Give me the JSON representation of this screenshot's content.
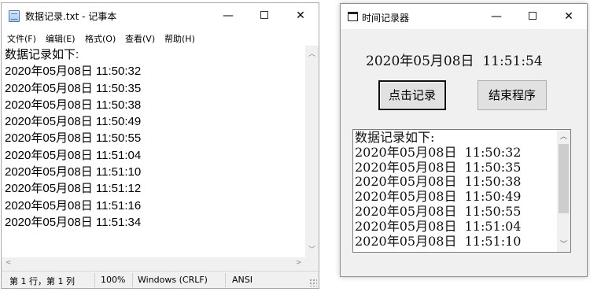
{
  "notepad": {
    "title": "数据记录.txt - 记事本",
    "controls": {
      "minimize": "—",
      "close": "✕"
    },
    "menu": [
      "文件(F)",
      "编辑(E)",
      "格式(O)",
      "查看(V)",
      "帮助(H)"
    ],
    "lines": [
      "数据记录如下:",
      "2020年05月08日 11:50:32",
      "2020年05月08日 11:50:35",
      "2020年05月08日 11:50:38",
      "2020年05月08日 11:50:49",
      "2020年05月08日 11:50:55",
      "2020年05月08日 11:51:04",
      "2020年05月08日 11:51:10",
      "2020年05月08日 11:51:12",
      "2020年05月08日 11:51:16",
      "2020年05月08日 11:51:34"
    ],
    "status": {
      "position": "第 1 行，第 1 列",
      "zoom": "100%",
      "line_ending": "Windows (CRLF)",
      "encoding": "ANSI"
    }
  },
  "recorder": {
    "title": "时间记录器",
    "controls": {
      "minimize": "—",
      "close": "✕"
    },
    "clock": "2020年05月08日  11:51:54",
    "record_button": "点击记录",
    "end_button": "结束程序",
    "list_lines": [
      "数据记录如下:",
      "2020年05月08日  11:50:32",
      "2020年05月08日  11:50:35",
      "2020年05月08日  11:50:38",
      "2020年05月08日  11:50:49",
      "2020年05月08日  11:50:55",
      "2020年05月08日  11:51:04",
      "2020年05月08日  11:51:10"
    ]
  }
}
